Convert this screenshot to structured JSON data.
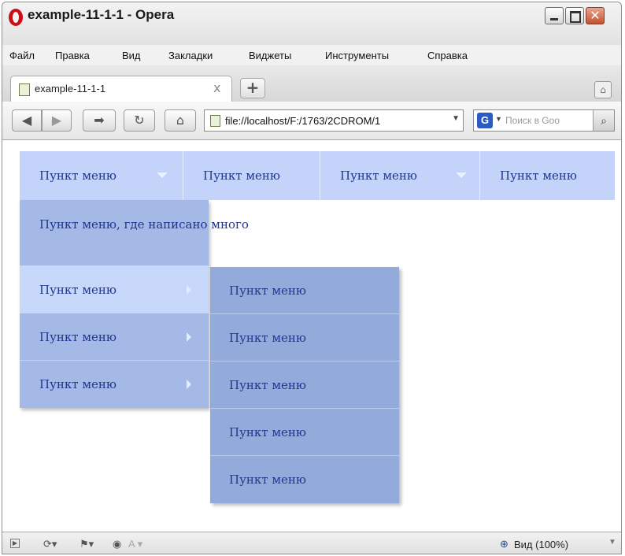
{
  "window": {
    "title": "example-11-1-1 - Opera"
  },
  "menubar": [
    "Файл",
    "Правка",
    "Вид",
    "Закладки",
    "Виджеты",
    "Инструменты",
    "Справка"
  ],
  "tab": {
    "title": "example-11-1-1",
    "close": "x"
  },
  "newtab": "+",
  "address": {
    "url": "file://localhost/F:/1763/2CDROM/1"
  },
  "search": {
    "placeholder": "Поиск в Goo"
  },
  "topnav": [
    "Пункт меню",
    "Пункт меню",
    "Пункт меню",
    "Пункт меню"
  ],
  "submenu1": [
    "Пункт меню, где написано много",
    "Пункт меню",
    "Пункт меню",
    "Пункт меню"
  ],
  "submenu2": [
    "Пункт меню",
    "Пункт меню",
    "Пункт меню",
    "Пункт меню",
    "Пункт меню"
  ],
  "status": {
    "zoom": "Вид (100%)"
  },
  "colors": {
    "topnav_bg": "#c3d3fa",
    "submenu1_bg": "#a4b9e6",
    "submenu1_active": "#c8d8fb",
    "submenu2_bg": "#93abdb",
    "menu_text": "#1f3690"
  }
}
